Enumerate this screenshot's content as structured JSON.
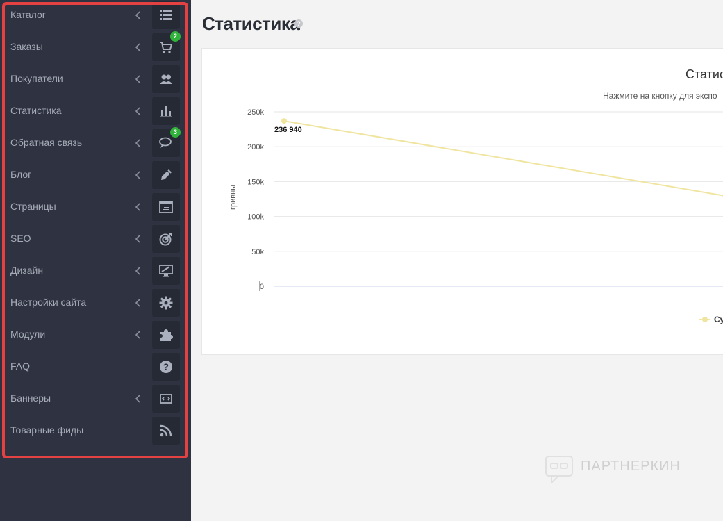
{
  "sidebar": {
    "items": [
      {
        "label": "Каталог",
        "icon": "list-icon",
        "has_chevron": true
      },
      {
        "label": "Заказы",
        "icon": "cart-icon",
        "has_chevron": true,
        "badge": "2"
      },
      {
        "label": "Покупатели",
        "icon": "users-icon",
        "has_chevron": true
      },
      {
        "label": "Статистика",
        "icon": "bar-chart-icon",
        "has_chevron": true
      },
      {
        "label": "Обратная связь",
        "icon": "chat-icon",
        "has_chevron": true,
        "badge": "3"
      },
      {
        "label": "Блог",
        "icon": "pencil-icon",
        "has_chevron": true
      },
      {
        "label": "Страницы",
        "icon": "page-icon",
        "has_chevron": true
      },
      {
        "label": "SEO",
        "icon": "target-icon",
        "has_chevron": true
      },
      {
        "label": "Дизайн",
        "icon": "monitor-icon",
        "has_chevron": true
      },
      {
        "label": "Настройки сайта",
        "icon": "gear-icon",
        "has_chevron": true
      },
      {
        "label": "Модули",
        "icon": "puzzle-icon",
        "has_chevron": true
      },
      {
        "label": "FAQ",
        "icon": "question-icon",
        "has_chevron": false
      },
      {
        "label": "Баннеры",
        "icon": "banner-icon",
        "has_chevron": true
      },
      {
        "label": "Товарные фиды",
        "icon": "rss-icon",
        "has_chevron": false
      }
    ]
  },
  "header": {
    "title": "Статистика"
  },
  "chart": {
    "title": "Статис",
    "subtitle": "Нажмите на кнопку для экспо",
    "legend_label": "Су"
  },
  "watermark": {
    "text": "ПАРТНЕРКИН"
  },
  "colors": {
    "sidebar_bg": "#2f3341",
    "icon_box_bg": "#262a35",
    "highlight": "#e34142",
    "badge": "#31b23a",
    "series": "#f0e5a0"
  },
  "chart_data": {
    "type": "line",
    "title": "Статис",
    "subtitle": "Нажмите на кнопку для экспо",
    "ylabel": "гривны",
    "ylim": [
      0,
      250000
    ],
    "yticks": [
      "0",
      "50k",
      "100k",
      "150k",
      "200k",
      "250k"
    ],
    "grid": true,
    "series": [
      {
        "name": "Су",
        "values": [
          236940,
          130000
        ],
        "labels": [
          "236 940",
          ""
        ]
      }
    ]
  }
}
